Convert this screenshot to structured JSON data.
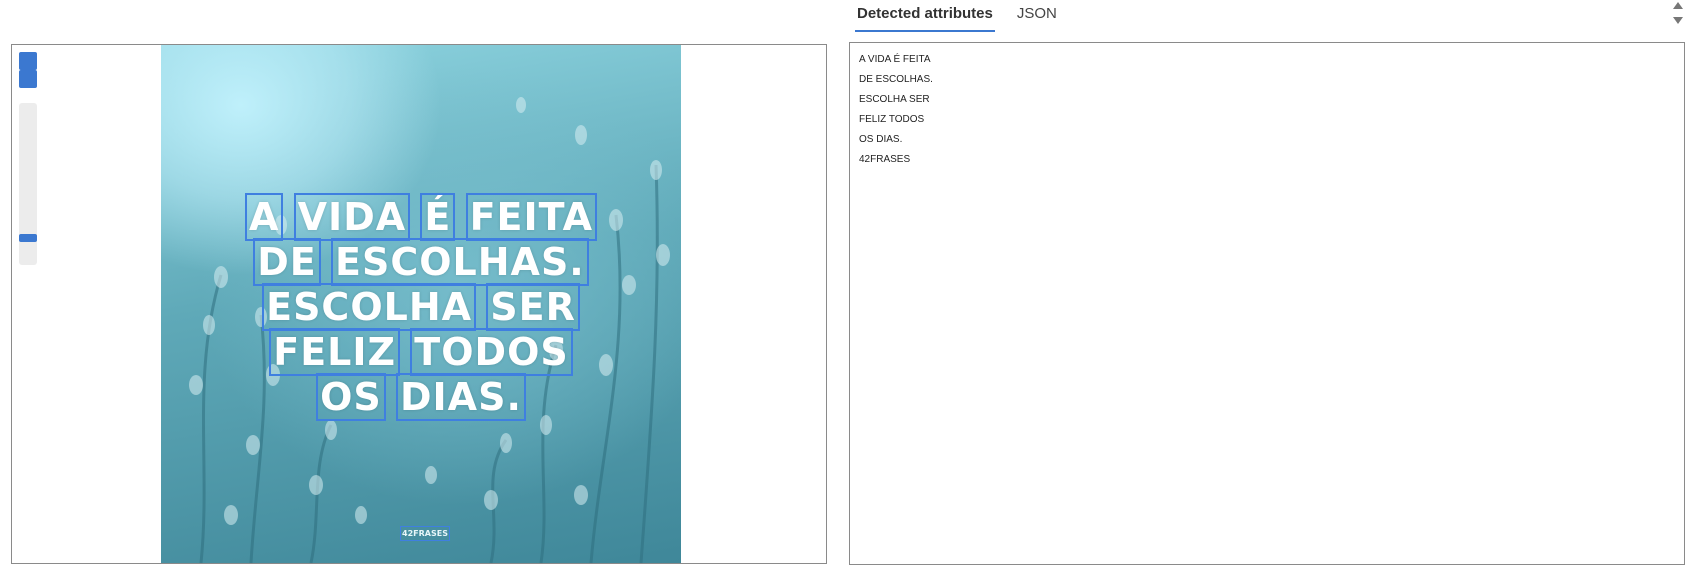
{
  "tabs": [
    {
      "label": "Detected attributes",
      "active": true
    },
    {
      "label": "JSON",
      "active": false
    }
  ],
  "viewer": {
    "zoom_in_icon": "zoom-in-icon",
    "zoom_out_icon": "zoom-out-icon",
    "zoom_level_fraction": 0.85
  },
  "image": {
    "lines": [
      [
        "A",
        "VIDA",
        "É",
        "FEITA"
      ],
      [
        "DE",
        "ESCOLHAS."
      ],
      [
        "ESCOLHA",
        "SER"
      ],
      [
        "FELIZ",
        "TODOS"
      ],
      [
        "OS",
        "DIAS."
      ]
    ],
    "watermark": "42FRASES"
  },
  "results": {
    "lines": [
      "A VIDA É FEITA",
      "DE ESCOLHAS.",
      "ESCOLHA SER",
      "FELIZ TODOS",
      "OS DIAS.",
      "42FRASES"
    ]
  },
  "colors": {
    "accent": "#3b78d0",
    "box": "#3f7fe0"
  }
}
